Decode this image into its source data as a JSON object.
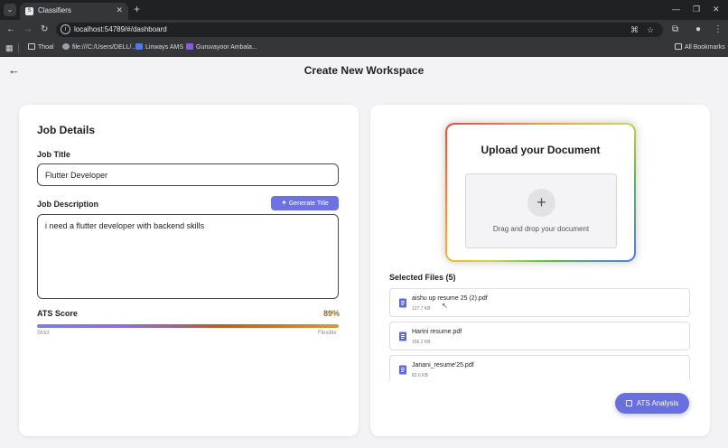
{
  "browser": {
    "tab_title": "Classifiers",
    "tab_close": "✕",
    "new_tab": "+",
    "url": "localhost:54789/#/dashboard",
    "all_bookmarks": "All Bookmarks",
    "bookmarks": [
      {
        "label": "Thoal",
        "color": "#cfcfcf"
      },
      {
        "label": "file:///C:/Users/DELL/...",
        "color": "#9aa0a6"
      },
      {
        "label": "Linways AMS",
        "color": "#4a7be8"
      },
      {
        "label": "Guruvayoor Ambala...",
        "color": "#8a5cd6"
      }
    ]
  },
  "page": {
    "title": "Create New Workspace",
    "back_icon": "←"
  },
  "job_details": {
    "heading": "Job Details",
    "job_title_label": "Job Title",
    "job_title_value": "Flutter Developer",
    "job_description_label": "Job Description",
    "generate_button": "Generate Title",
    "job_description_value": "i need a flutter developer with backend skills",
    "ats_label": "ATS Score",
    "ats_value": "89%",
    "ats_fraction": 0.89,
    "ats_min_label": "Strict",
    "ats_max_label": "Flexible"
  },
  "upload": {
    "title": "Upload your Document",
    "drop_text": "Drag and drop your document",
    "plus": "+",
    "files_heading": "Selected Files (5)",
    "files": [
      {
        "name": "aishu up resume 25 (2).pdf",
        "size": "127.7 KB"
      },
      {
        "name": "Harini resume.pdf",
        "size": "156.2 KB"
      },
      {
        "name": "Janani_resume'25.pdf",
        "size": "82.6 KB"
      }
    ]
  },
  "fab": {
    "label": "ATS Analysis"
  },
  "colors": {
    "accent": "#6a6fe0",
    "ats_value": "#8a6d2e"
  }
}
